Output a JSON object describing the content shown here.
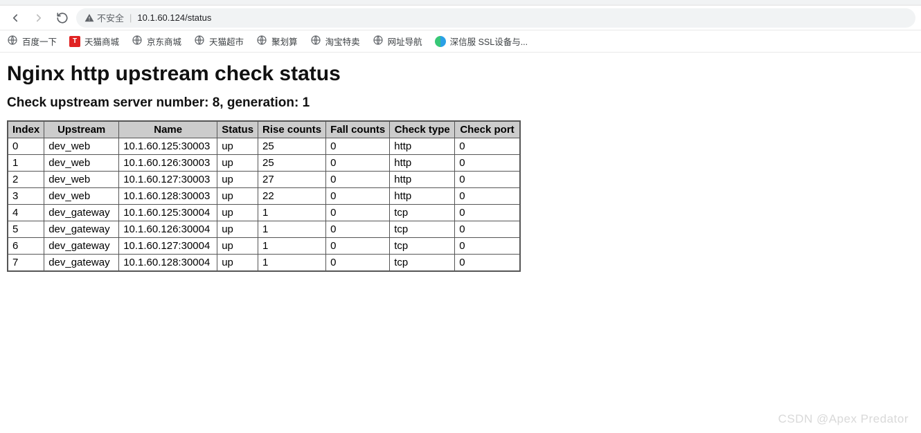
{
  "browser": {
    "not_secure_label": "不安全",
    "url": "10.1.60.124/status"
  },
  "bookmarks": [
    {
      "label": "百度一下",
      "icon": "globe"
    },
    {
      "label": "天猫商城",
      "icon": "tmall"
    },
    {
      "label": "京东商城",
      "icon": "globe"
    },
    {
      "label": "天猫超市",
      "icon": "globe"
    },
    {
      "label": "聚划算",
      "icon": "globe"
    },
    {
      "label": "淘宝特卖",
      "icon": "globe"
    },
    {
      "label": "网址导航",
      "icon": "globe"
    },
    {
      "label": "深信服 SSL设备与...",
      "icon": "sf"
    }
  ],
  "page": {
    "title": "Nginx http upstream check status",
    "subtitle": "Check upstream server number: 8, generation: 1"
  },
  "table": {
    "headers": {
      "index": "Index",
      "upstream": "Upstream",
      "name": "Name",
      "status": "Status",
      "rise": "Rise counts",
      "fall": "Fall counts",
      "type": "Check type",
      "port": "Check port"
    },
    "rows": [
      {
        "index": "0",
        "upstream": "dev_web",
        "name": "10.1.60.125:30003",
        "status": "up",
        "rise": "25",
        "fall": "0",
        "type": "http",
        "port": "0"
      },
      {
        "index": "1",
        "upstream": "dev_web",
        "name": "10.1.60.126:30003",
        "status": "up",
        "rise": "25",
        "fall": "0",
        "type": "http",
        "port": "0"
      },
      {
        "index": "2",
        "upstream": "dev_web",
        "name": "10.1.60.127:30003",
        "status": "up",
        "rise": "27",
        "fall": "0",
        "type": "http",
        "port": "0"
      },
      {
        "index": "3",
        "upstream": "dev_web",
        "name": "10.1.60.128:30003",
        "status": "up",
        "rise": "22",
        "fall": "0",
        "type": "http",
        "port": "0"
      },
      {
        "index": "4",
        "upstream": "dev_gateway",
        "name": "10.1.60.125:30004",
        "status": "up",
        "rise": "1",
        "fall": "0",
        "type": "tcp",
        "port": "0"
      },
      {
        "index": "5",
        "upstream": "dev_gateway",
        "name": "10.1.60.126:30004",
        "status": "up",
        "rise": "1",
        "fall": "0",
        "type": "tcp",
        "port": "0"
      },
      {
        "index": "6",
        "upstream": "dev_gateway",
        "name": "10.1.60.127:30004",
        "status": "up",
        "rise": "1",
        "fall": "0",
        "type": "tcp",
        "port": "0"
      },
      {
        "index": "7",
        "upstream": "dev_gateway",
        "name": "10.1.60.128:30004",
        "status": "up",
        "rise": "1",
        "fall": "0",
        "type": "tcp",
        "port": "0"
      }
    ]
  },
  "watermark": "CSDN @Apex    Predator"
}
